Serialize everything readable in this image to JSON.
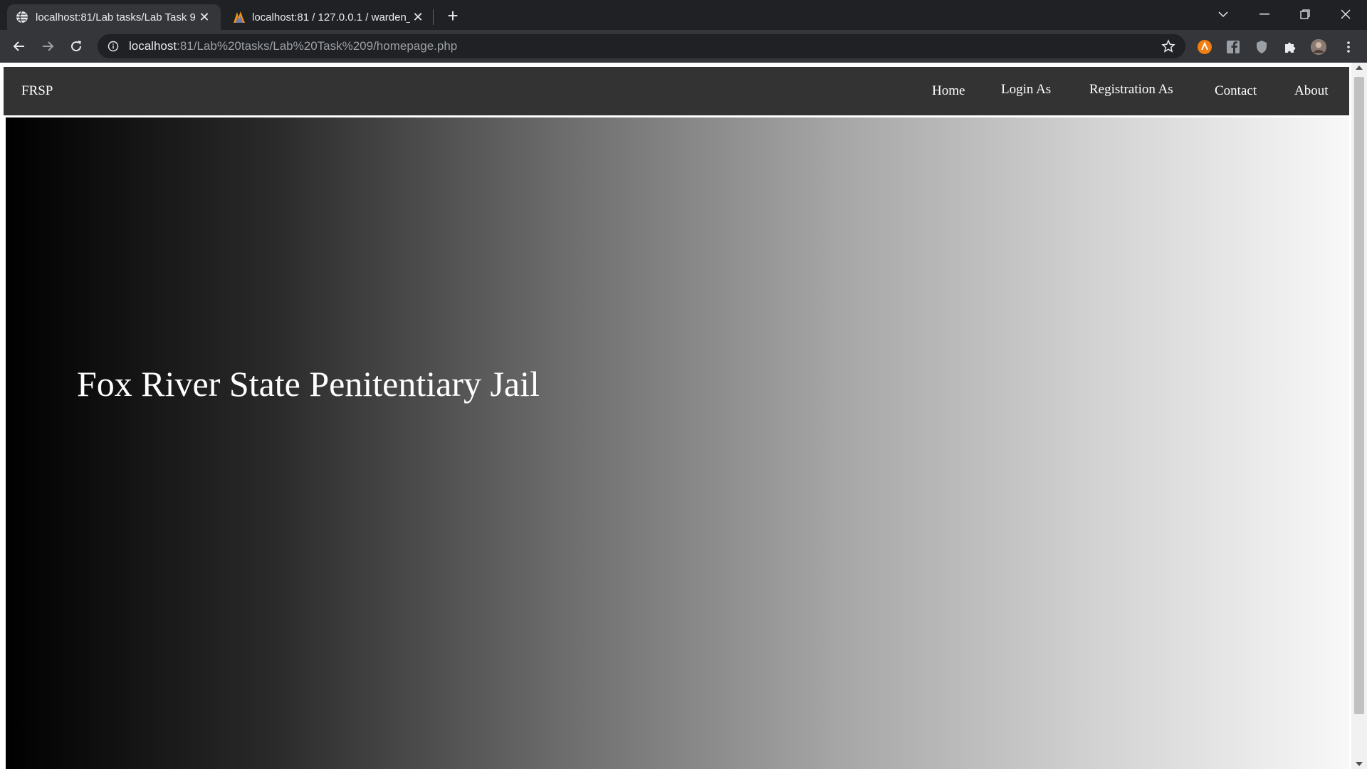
{
  "browser": {
    "tabs": [
      {
        "title": "localhost:81/Lab tasks/Lab Task 9",
        "active": true,
        "favicon": "globe-icon"
      },
      {
        "title": "localhost:81 / 127.0.0.1 / warden_",
        "active": false,
        "favicon": "phpmyadmin-icon"
      }
    ],
    "new_tab_label": "+",
    "address": {
      "host": "localhost",
      "path": ":81/Lab%20tasks/Lab%20Task%209/homepage.php"
    },
    "colors": {
      "frame": "#202124",
      "toolbar": "#35363a",
      "text": "#e8eaed"
    }
  },
  "site": {
    "brand": "FRSP",
    "nav": {
      "home": "Home",
      "login": "Login As",
      "registration": "Registration As",
      "contact": "Contact",
      "about": "About"
    },
    "hero_title": "Fox River State Penitentiary Jail",
    "colors": {
      "navbar": "#333333",
      "hero_gradient_start": "#000000",
      "hero_gradient_end": "#f8f8f8"
    }
  }
}
